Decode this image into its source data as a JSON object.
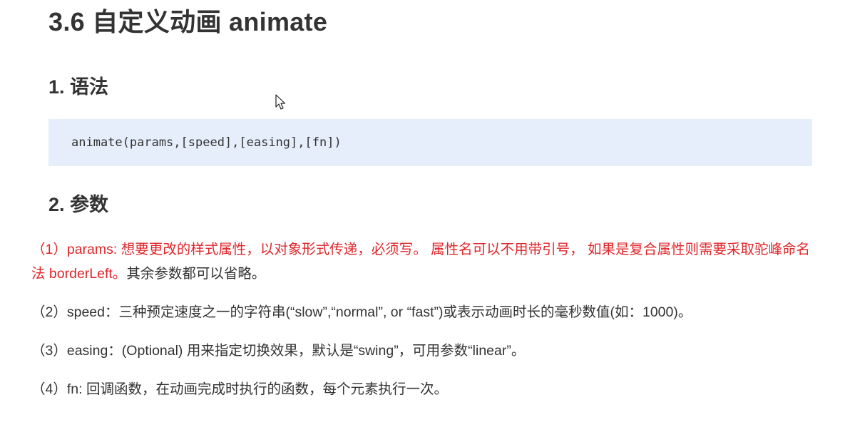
{
  "title": "3.6  自定义动画 animate",
  "syntax": {
    "heading": "1. 语法",
    "code": "animate(params,[speed],[easing],[fn])"
  },
  "params": {
    "heading": "2. 参数",
    "p1": {
      "red": "（1）params: 想要更改的样式属性，以对象形式传递，必须写。 属性名可以不用带引号， 如果是复合属性则需要采取驼峰命名法 borderLeft。",
      "rest": "其余参数都可以省略。"
    },
    "p2": "（2）speed：三种预定速度之一的字符串(“slow”,“normal”, or “fast”)或表示动画时长的毫秒数值(如：1000)。",
    "p3": "（3）easing：(Optional) 用来指定切换效果，默认是“swing”，可用参数“linear”。",
    "p4": "（4）fn:  回调函数，在动画完成时执行的函数，每个元素执行一次。"
  },
  "icons": {
    "cursor": "mouse-pointer-icon"
  },
  "colors": {
    "text": "#333333",
    "highlight": "#e0262b",
    "code_background": "#e6eefb"
  }
}
